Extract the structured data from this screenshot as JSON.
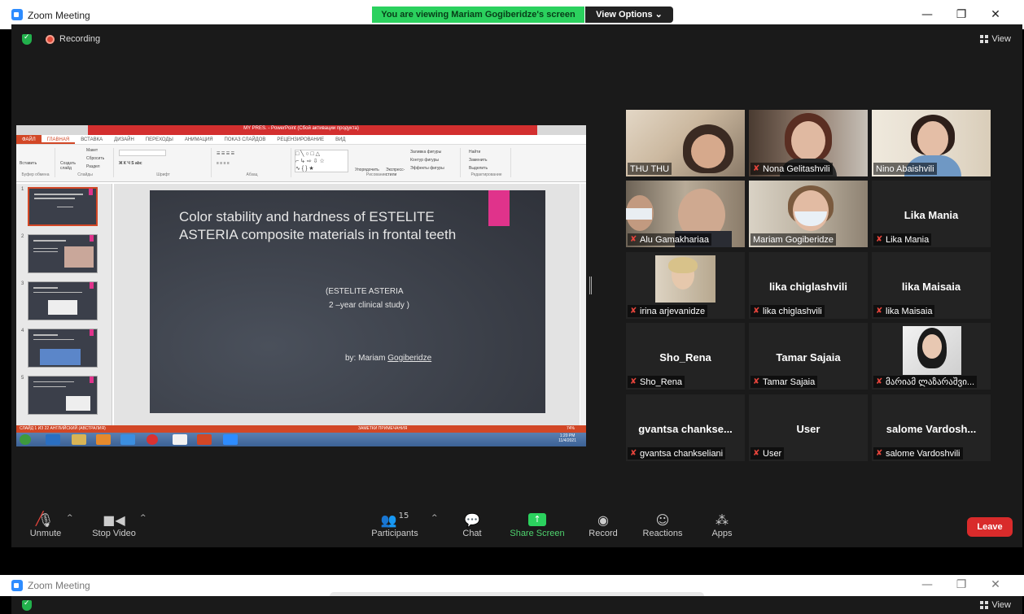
{
  "window": {
    "app_title": "Zoom Meeting",
    "minimize": "—",
    "restore": "❐",
    "close": "✕"
  },
  "banner": {
    "text": "You are viewing Mariam Gogiberidze's screen",
    "view_options": "View Options ⌄"
  },
  "meeting": {
    "recording_label": "Recording",
    "view_label": "View"
  },
  "slide": {
    "title": "Color stability and hardness of ESTELITE ASTERIA composite materials in frontal teeth",
    "subtitle_line1": "(ESTELITE ASTERIA",
    "subtitle_line2": "2 –year clinical study )",
    "byline_prefix": "by: Mariam ",
    "byline_name": "Gogiberidze"
  },
  "powerpoint": {
    "window_title": "MY PRES. - PowerPoint (Сбой активации продукта)",
    "tabs": [
      "ФАЙЛ",
      "ГЛАВНАЯ",
      "ВСТАВКА",
      "ДИЗАЙН",
      "ПЕРЕХОДЫ",
      "АНИМАЦИЯ",
      "ПОКАЗ СЛАЙДОВ",
      "РЕЦЕНЗИРОВАНИЕ",
      "ВИД"
    ],
    "groups": [
      "Буфер обмена",
      "Слайды",
      "Шрифт",
      "Абзац",
      "Рисование",
      "Редактирование"
    ],
    "ribbon_items": {
      "paste": "Вставить",
      "create_slide": "Создать слайд",
      "layout": "Макет",
      "reset": "Сбросить",
      "section": "Раздел",
      "arrange": "Упорядочить",
      "quick_styles": "Экспресс-стили",
      "fill": "Заливка фигуры",
      "outline": "Контур фигуры",
      "effects": "Эффекты фигуры",
      "find": "Найти",
      "replace": "Заменить",
      "select": "Выделить"
    },
    "thumb_numbers": [
      "1",
      "2",
      "3",
      "4",
      "5"
    ],
    "status_left": "СЛАЙД 1 ИЗ 22    АНГЛИЙСКИЙ (АВСТРАЛИЯ)",
    "status_right": "ЗАМЕТКИ    ПРИМЕЧАНИЯ",
    "zoom_pct": "74%",
    "clock_time": "1:20 PM",
    "clock_date": "11/4/2021"
  },
  "participants": [
    {
      "name": "THU THU",
      "muted": false,
      "video": true
    },
    {
      "name": "Nona Gelitashvili",
      "muted": true,
      "video": true
    },
    {
      "name": "Nino Abaishvili",
      "muted": false,
      "video": true
    },
    {
      "name": "Alu Gamakhariaa",
      "muted": true,
      "video": true
    },
    {
      "name": "Mariam Gogiberidze",
      "muted": false,
      "video": true,
      "active": true
    },
    {
      "name": "Lika Mania",
      "big": "Lika Mania",
      "muted": true,
      "video": false
    },
    {
      "name": "irina arjevanidze",
      "muted": true,
      "video": true
    },
    {
      "name": "lika chiglashvili",
      "big": "lika chiglashvili",
      "muted": true,
      "video": false
    },
    {
      "name": "lika Maisaia",
      "big": "lika Maisaia",
      "muted": true,
      "video": false
    },
    {
      "name": "Sho_Rena",
      "big": "Sho_Rena",
      "muted": true,
      "video": false
    },
    {
      "name": "Tamar Sajaia",
      "big": "Tamar Sajaia",
      "muted": true,
      "video": false
    },
    {
      "name": "მარიამ ლაზარაშვი...",
      "muted": true,
      "video": true
    },
    {
      "name": "gvantsa chankseliani",
      "big": "gvantsa  chankse...",
      "muted": true,
      "video": false
    },
    {
      "name": "User",
      "big": "User",
      "muted": true,
      "video": false
    },
    {
      "name": "salome Vardoshvili",
      "big": "salome  Vardosh...",
      "muted": true,
      "video": false
    }
  ],
  "toolbar": {
    "unmute": "Unmute",
    "stop_video": "Stop Video",
    "participants": "Participants",
    "participants_count": "15",
    "chat": "Chat",
    "share_screen": "Share Screen",
    "record": "Record",
    "reactions": "Reactions",
    "apps": "Apps",
    "leave": "Leave"
  },
  "window2": {
    "app_title": "Zoom Meeting",
    "view_label": "View"
  },
  "colors": {
    "banner_green": "#2bd15e",
    "leave_red": "#d92b2b",
    "ppt_orange": "#d24726",
    "slide_pink": "#e0338b",
    "active_speaker": "#c7e05a"
  }
}
